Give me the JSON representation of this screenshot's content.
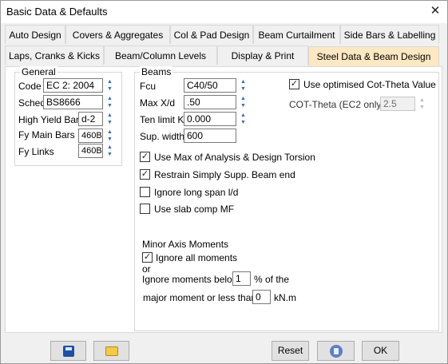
{
  "window": {
    "title": "Basic Data & Defaults",
    "close_glyph": "✕"
  },
  "tabs_row1": [
    "Auto Design",
    "Covers & Aggregates",
    "Col & Pad Design",
    "Beam Curtailment",
    "Side Bars & Labelling"
  ],
  "tabs_row2": [
    "Laps, Cranks & Kicks",
    "Beam/Column Levels",
    "Display & Print",
    "Steel Data & Beam Design"
  ],
  "active_tab": "Steel Data & Beam Design",
  "general": {
    "title": "General",
    "code_label": "Code",
    "code_value": "EC 2: 2004",
    "sched_label": "Sched",
    "sched_value": "BS8666",
    "high_yield_label": "High Yield Bars",
    "high_yield_value": "d-2",
    "fy_main_label": "Fy Main Bars",
    "fy_main_value": "460B",
    "fy_links_label": "Fy Links",
    "fy_links_value": "460B"
  },
  "beams": {
    "title": "Beams",
    "fcu_label": "Fcu",
    "fcu_value": "C40/50",
    "max_xd_label": "Max X/d",
    "max_xd_value": ".50",
    "ten_limit_label": "Ten limit K'",
    "ten_limit_value": "0.000",
    "sup_width_label": "Sup. width",
    "sup_width_value": "600"
  },
  "cot_theta": {
    "use_label": "Use optimised Cot-Theta Value",
    "use_checked": true,
    "label": "COT-Theta (EC2 only)",
    "value": "2.5"
  },
  "options": [
    {
      "label": "Use Max of Analysis & Design Torsion",
      "checked": true
    },
    {
      "label": "Restrain Simply Supp. Beam end",
      "checked": true
    },
    {
      "label": "Ignore long span l/d",
      "checked": false
    },
    {
      "label": "Use slab comp MF",
      "checked": false
    }
  ],
  "minor_axis": {
    "title": "Minor Axis Moments",
    "ignore_all_label": "Ignore all moments",
    "ignore_all_checked": true,
    "or_text": "or",
    "below_label": "Ignore moments below",
    "below_value": "1",
    "below_suffix": "% of the",
    "major_label": "major moment or less than",
    "major_value": "0",
    "major_suffix": "kN.m"
  },
  "footer": {
    "reset_label": "Reset",
    "ok_label": "OK"
  },
  "icons": {
    "save": "save-disk-icon",
    "open": "open-folder-icon",
    "help": "help-icon",
    "spin_up": "▲",
    "spin_down": "▼",
    "check": "✓"
  }
}
